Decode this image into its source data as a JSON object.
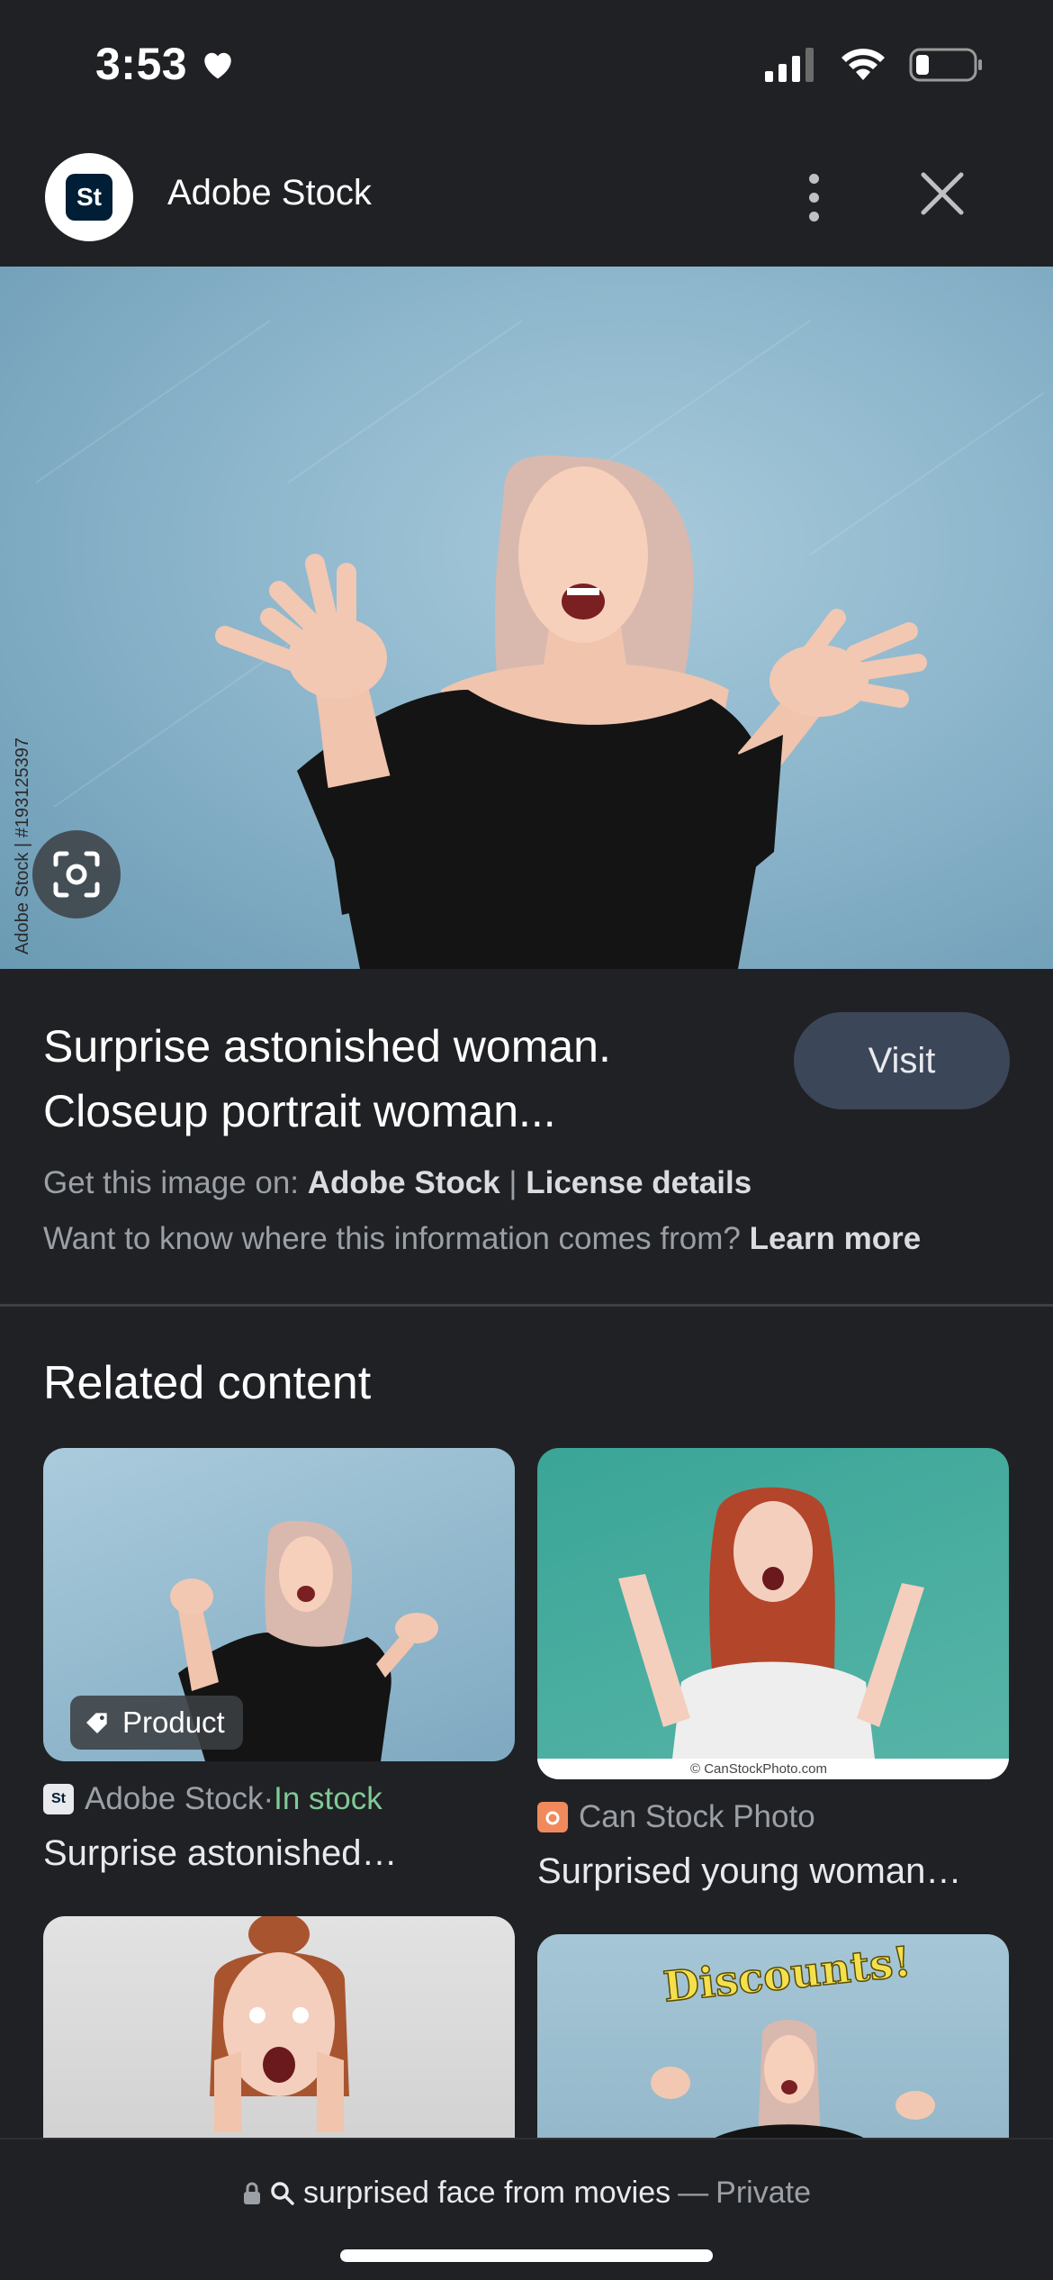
{
  "status_bar": {
    "time": "3:53"
  },
  "header": {
    "source_name": "Adobe Stock",
    "logo_text": "St"
  },
  "hero": {
    "credit": "Adobe Stock | #193125397"
  },
  "info": {
    "title_line1": "Surprise astonished woman.",
    "title_line2": "Closeup portrait woman...",
    "visit_label": "Visit",
    "get_image_prefix": "Get this image on: ",
    "get_image_source": "Adobe Stock",
    "separator": " | ",
    "license_link": "License details",
    "where_prefix": "Want to know where this information comes from? ",
    "learn_more": "Learn more"
  },
  "related": {
    "heading": "Related content",
    "cards": [
      {
        "source": "Adobe Stock",
        "stock_sep": " · ",
        "stock_status": "In stock",
        "title": "Surprise astonished…",
        "chip": "Product"
      },
      {
        "source": "Can Stock Photo",
        "title": "Surprised young woman…",
        "watermark": "© CanStockPhoto.com"
      },
      {
        "source": "",
        "title": ""
      },
      {
        "source": "",
        "title": "",
        "banner": "Discounts!"
      }
    ]
  },
  "bottom_bar": {
    "query": "surprised face from movies",
    "separator": " — ",
    "mode": "Private"
  },
  "colors": {
    "background": "#202124",
    "visit_button": "#3c4659",
    "in_stock": "#81c995",
    "muted_text": "#9aa0a6"
  }
}
